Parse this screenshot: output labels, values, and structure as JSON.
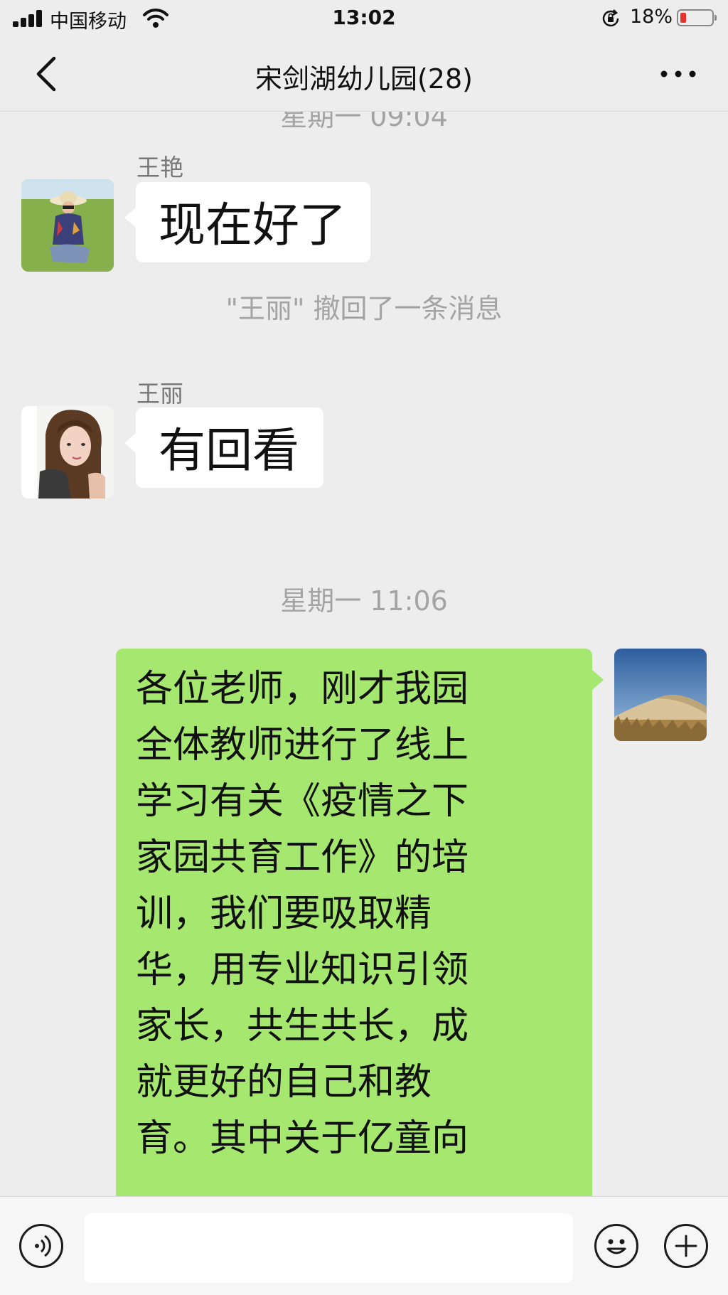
{
  "status_bar": {
    "carrier": "中国移动",
    "time": "13:02",
    "battery_percent": "18%",
    "battery_level": 0.18,
    "battery_color": "#e8312f"
  },
  "nav": {
    "back_icon": "chevron-left-icon",
    "title": "宋剑湖幼儿园(28)",
    "more_icon": "more-dots-icon"
  },
  "chat": {
    "time_labels": [
      "星期一 09:04",
      "星期一 11:06"
    ],
    "system_message": "\"王丽\" 撤回了一条消息",
    "messages": [
      {
        "sender": "王艳",
        "text": "现在好了",
        "side": "left"
      },
      {
        "sender": "王丽",
        "text": "有回看",
        "side": "left"
      },
      {
        "sender": "",
        "side": "right",
        "lines": [
          "各位老师，刚才我园",
          "全体教师进行了线上",
          "学习有关《疫情之下",
          "家园共育工作》的培",
          "训，我们要吸取精",
          "华，用专业知识引领",
          "家长，共生共长，成",
          "就更好的自己和教",
          "育。其中关于亿童向"
        ]
      }
    ],
    "bubble_colors": {
      "incoming": "#ffffff",
      "outgoing": "#a5e76f"
    }
  },
  "input_bar": {
    "voice_icon": "voice-icon",
    "input_value": "",
    "emoji_icon": "emoji-icon",
    "plus_icon": "plus-icon"
  }
}
